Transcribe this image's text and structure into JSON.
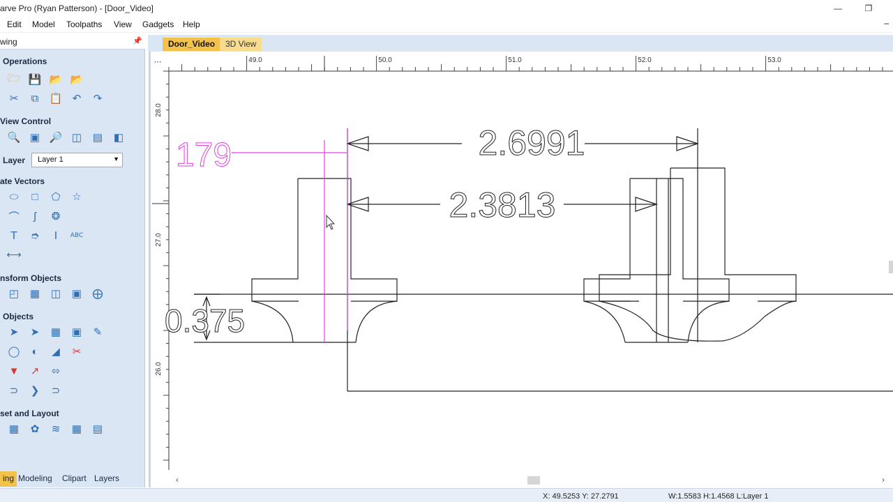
{
  "window": {
    "title": "arve Pro (Ryan Patterson) - [Door_Video]",
    "minimize_icon": "minimize-icon",
    "restore_icon": "restore-icon"
  },
  "menu": {
    "items": [
      "Edit",
      "Model",
      "Toolpaths",
      "View",
      "Gadgets",
      "Help"
    ],
    "mdi_minimize": "–"
  },
  "panel": {
    "title": "wing",
    "pin": "pin-icon",
    "sections": {
      "file_ops": "Operations",
      "view_control": "View Control",
      "create_vectors": "ate Vectors",
      "transform": "nsform Objects",
      "edit_objects": "Objects",
      "offset_layout": "set and Layout"
    },
    "layer_label": "Layer",
    "layer_value": "Layer 1",
    "bottom_tabs": [
      "ing",
      "Modeling",
      "Clipart",
      "Layers"
    ]
  },
  "doc_tabs": [
    "Door_Video",
    "3D View"
  ],
  "ruler": {
    "h_labels": [
      "49.0",
      "50.0",
      "51.0",
      "52.0",
      "53.0"
    ],
    "v_labels": [
      "28.0",
      "27.0",
      "26.0"
    ]
  },
  "drawing": {
    "dim_top": "2.6991",
    "dim_mid": "2.3813",
    "dim_left_magenta": "179",
    "dim_left_bottom": "0.375"
  },
  "status": {
    "coords": "X: 49.5253 Y: 27.2791",
    "size": "W:1.5583   H:1.4568  L:Layer 1"
  },
  "colors": {
    "panel_bg": "#dbe6f4",
    "tab_active": "#f3c24b",
    "magenta": "#e040e0"
  }
}
